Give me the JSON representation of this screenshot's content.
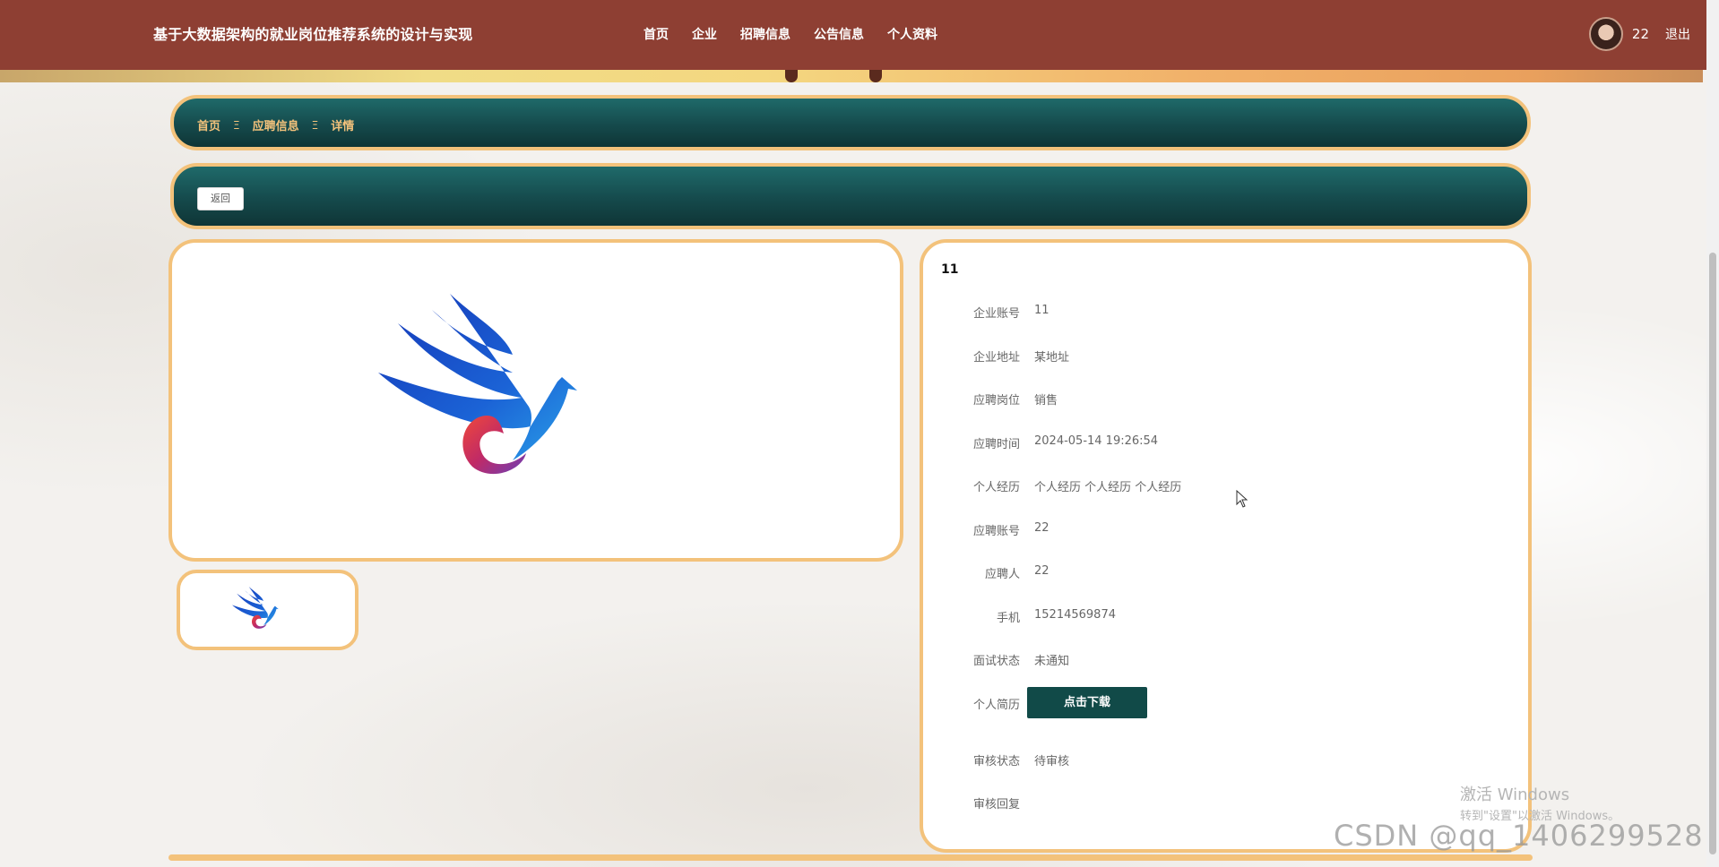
{
  "header": {
    "site_title": "基于大数据架构的就业岗位推荐系统的设计与实现",
    "nav": [
      "首页",
      "企业",
      "招聘信息",
      "公告信息",
      "个人资料"
    ],
    "username": "22",
    "logout_label": "退出"
  },
  "breadcrumb": {
    "items": [
      "首页",
      "应聘信息",
      "详情"
    ],
    "separator": "Ξ"
  },
  "actions": {
    "back_label": "返回"
  },
  "detail": {
    "title": "11",
    "fields": [
      {
        "label": "企业账号",
        "value": "11"
      },
      {
        "label": "企业地址",
        "value": "某地址"
      },
      {
        "label": "应聘岗位",
        "value": "销售"
      },
      {
        "label": "应聘时间",
        "value": "2024-05-14 19:26:54"
      },
      {
        "label": "个人经历",
        "value": "个人经历 个人经历 个人经历"
      },
      {
        "label": "应聘账号",
        "value": "22"
      },
      {
        "label": "应聘人",
        "value": "22"
      },
      {
        "label": "手机",
        "value": "15214569874"
      },
      {
        "label": "面试状态",
        "value": "未通知"
      }
    ],
    "resume": {
      "label": "个人简历",
      "button_label": "点击下载"
    },
    "fields_after": [
      {
        "label": "审核状态",
        "value": "待审核"
      },
      {
        "label": "审核回复",
        "value": ""
      }
    ]
  },
  "overlay": {
    "activate_title": "激活 Windows",
    "activate_sub": "转到\"设置\"以激活 Windows。",
    "watermark": "CSDN @qq_1406299528"
  },
  "colors": {
    "header_bg": "#8e3f33",
    "panel_border": "#f3c27b",
    "panel_teal": "#154a4c",
    "download_btn": "#114a48"
  },
  "icons": {
    "logo": "blue-eagle-logo",
    "cursor": "mouse-pointer-icon"
  }
}
